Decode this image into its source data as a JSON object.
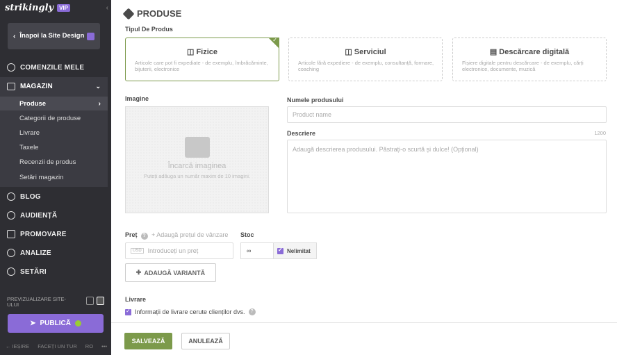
{
  "sidebar": {
    "logo": "strikingly",
    "vip": "VIP",
    "back_label": "Înapoi la Site Design",
    "nav": {
      "orders": "COMENZILE MELE",
      "store": "MAGAZIN",
      "blog": "BLOG",
      "audience": "AUDIENȚĂ",
      "promote": "PROMOVARE",
      "analytics": "ANALIZE",
      "settings": "SETĂRI"
    },
    "store_items": [
      "Produse",
      "Categorii de produse",
      "Livrare",
      "Taxele",
      "Recenzii de produs",
      "Setări magazin"
    ],
    "preview_label": "PREVIZUALIZARE SITE-ULUI",
    "publish_label": "PUBLICĂ",
    "exit_label": "IEȘIRE",
    "tour_label": "FACEȚI UN TUR",
    "lang": "RO"
  },
  "main": {
    "title": "PRODUSE",
    "type_label": "Tipul De Produs",
    "types": [
      {
        "name": "Fizice",
        "desc": "Articole care pot fi expediate - de exemplu, îmbrăcăminte, bijuterii, electronice"
      },
      {
        "name": "Serviciul",
        "desc": "Articole fără expediere - de exemplu, consultanță, formare, coaching"
      },
      {
        "name": "Descărcare digitală",
        "desc": "Fișiere digitale pentru descărcare - de exemplu, cărți electronice, documente, muzică"
      }
    ],
    "image_label": "Imagine",
    "upload_title": "Încarcă imaginea",
    "upload_hint": "Puteți adăuga un număr maxim de 10 imagini.",
    "name_label": "Numele produsului",
    "name_placeholder": "Product name",
    "desc_label": "Descriere",
    "desc_counter": "1200",
    "desc_placeholder": "Adaugă descrierea produsului. Păstrați-o scurtă și dulce! (Opțional)",
    "price_label": "Preț",
    "price_help": "+ Adaugă prețul de vânzare",
    "currency": "USD",
    "price_placeholder": "Introduceți un preț",
    "stock_label": "Stoc",
    "stock_value": "∞",
    "unlimited_label": "Nelimitat",
    "variant_label": "ADAUGĂ VARIANTĂ",
    "shipping_label": "Livrare",
    "shipping_check": "Informații de livrare cerute clienților dvs."
  },
  "footer": {
    "save": "SALVEAZĂ",
    "cancel": "ANULEAZĂ"
  },
  "colors": {
    "accent_green": "#7c9a4b",
    "accent_purple": "#8a6bd7",
    "sidebar_bg": "#2e2e33"
  }
}
